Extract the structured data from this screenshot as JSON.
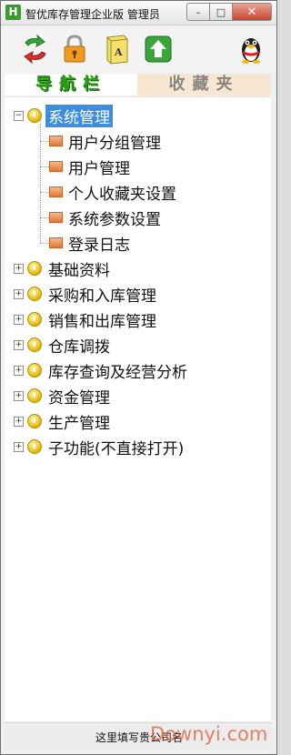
{
  "window": {
    "app_icon_letter": "H",
    "title": "智优库存管理企业版 管理员",
    "controls": {
      "minimize": "–",
      "maximize": "□",
      "close": "✕"
    }
  },
  "toolbar": {
    "icons": [
      "refresh-arrow-icon",
      "lock-icon",
      "book-icon",
      "upload-icon",
      "qq-penguin-icon"
    ]
  },
  "tabs": {
    "nav": "导航栏",
    "favorites": "收藏夹"
  },
  "tree": {
    "roots": [
      {
        "label": "系统管理",
        "expanded": true,
        "selected": true,
        "children": [
          "用户分组管理",
          "用户管理",
          "个人收藏夹设置",
          "系统参数设置",
          "登录日志"
        ]
      },
      {
        "label": "基础资料"
      },
      {
        "label": "采购和入库管理"
      },
      {
        "label": "销售和出库管理"
      },
      {
        "label": "仓库调拨"
      },
      {
        "label": "库存查询及经营分析"
      },
      {
        "label": "资金管理"
      },
      {
        "label": "生产管理"
      },
      {
        "label": "子功能(不直接打开)"
      }
    ],
    "expander_expanded": "−",
    "expander_collapsed": "+"
  },
  "status": {
    "text": "这里填写贵公司名",
    "watermark": "Downyi.com"
  },
  "colors": {
    "selection": "#3d8ee0",
    "nav_tab_text": "#2ea318",
    "favorites_tab_bg": "#f7e6d2",
    "close_button": "#c8432c"
  }
}
